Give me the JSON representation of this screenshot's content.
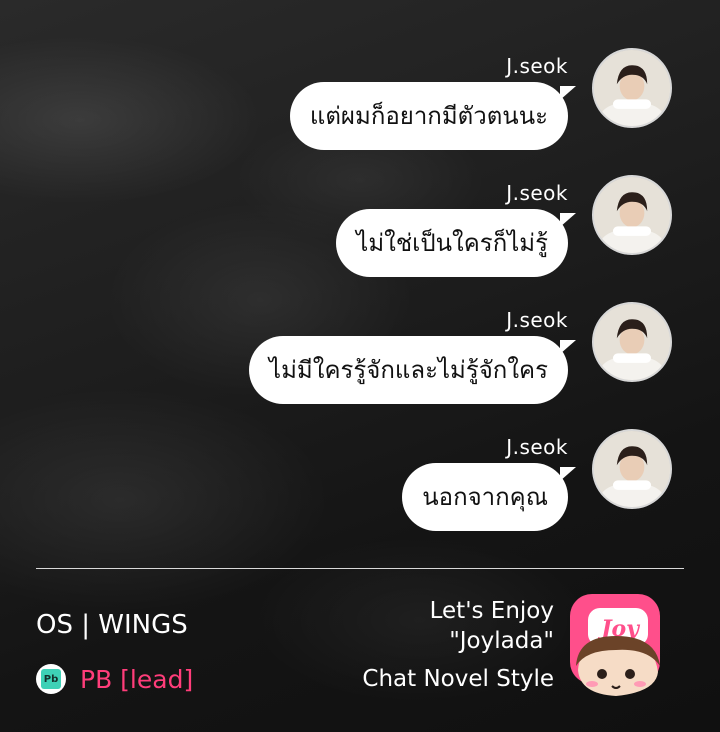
{
  "messages": [
    {
      "sender": "J.seok",
      "text": "แต่ผมก็อยากมีตัวตนนะ"
    },
    {
      "sender": "J.seok",
      "text": "ไม่ใช่เป็นใครก็ไม่รู้"
    },
    {
      "sender": "J.seok",
      "text": "ไม่มีใครรู้จักและไม่รู้จักใคร"
    },
    {
      "sender": "J.seok",
      "text": "นอกจากคุณ"
    }
  ],
  "footer": {
    "title": "OS | WINGS",
    "pb_icon_text": "Pb",
    "pb_label": "PB [lead]",
    "promo_line1": "Let's Enjoy",
    "promo_line2": "\"Joylada\"",
    "promo_line3": "Chat Novel Style",
    "logo_text": "Joy"
  },
  "colors": {
    "bubble": "#ffffff",
    "accent_pink": "#ff3d7a",
    "logo_pink": "#ff4f8b",
    "pb_green": "#3ed1b6"
  },
  "icons": [
    "avatar",
    "pb-icon",
    "joylada-logo"
  ]
}
